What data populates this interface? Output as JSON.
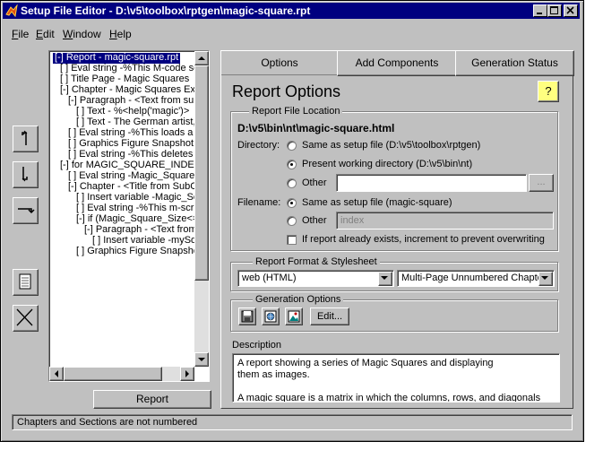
{
  "window": {
    "title": "Setup File Editor - D:\\v5\\toolbox\\rptgen\\magic-square.rpt"
  },
  "menu": [
    {
      "label": "File",
      "accel": "F",
      "rest": "ile"
    },
    {
      "label": "Edit",
      "accel": "E",
      "rest": "dit"
    },
    {
      "label": "Window",
      "accel": "W",
      "rest": "indow"
    },
    {
      "label": "Help",
      "accel": "H",
      "rest": "elp"
    }
  ],
  "tree": [
    "[-] Report - magic-square.rpt",
    "[ ] Eval string -%This M-code se",
    "[ ] Title Page - Magic Squares",
    "[-] Chapter - Magic Squares Exp",
    "[-] Paragraph - <Text from sub",
    "[ ] Text - %<help('magic')>",
    "[ ] Text - The German artist,",
    "[ ] Eval string -%This loads a s",
    "[ ] Graphics Figure Snapshot",
    "[ ] Eval string -%This deletes t",
    "[-] for MAGIC_SQUARE_INDEX",
    "[ ] Eval string -Magic_Square_",
    "[-] Chapter - <Title from SubCo",
    "[ ] Insert variable -Magic_Sc",
    "[ ] Eval string -%This m-scrip",
    "[-] if (Magic_Square_Size<=",
    "[-] Paragraph - <Text from",
    "[ ] Insert variable -mySqu",
    "[ ] Graphics Figure Snapshot"
  ],
  "report_button": "Report",
  "tabs": [
    "Options",
    "Add Components",
    "Generation Status"
  ],
  "options": {
    "heading": "Report Options",
    "help_glyph": "?",
    "file_location": {
      "group_title": "Report File Location",
      "path": "D:\\v5\\bin\\nt\\magic-square.html",
      "directory_label": "Directory:",
      "dir_options": [
        "Same as setup file (D:\\v5\\toolbox\\rptgen)",
        "Present working directory (D:\\v5\\bin\\nt)",
        "Other"
      ],
      "dir_selected": 1,
      "other_dir_value": "",
      "browse_label": "...",
      "filename_label": "Filename:",
      "file_options": [
        "Same as setup file (magic-square)",
        "Other"
      ],
      "file_selected": 0,
      "other_file_value": "index",
      "increment_label": "If report already exists, increment to prevent overwriting",
      "increment_checked": false
    },
    "format": {
      "group_title": "Report Format & Stylesheet",
      "format_value": "web (HTML)",
      "stylesheet_value": "Multi-Page Unnumbered Chapter"
    },
    "generation": {
      "group_title": "Generation Options",
      "edit_label": "Edit..."
    },
    "description": {
      "label": "Description",
      "lines": [
        "A report showing a series of Magic Squares and displaying",
        "them as images.",
        "",
        "A magic square is a matrix in which the columns, rows, and diagonals"
      ]
    }
  },
  "status_text": "Chapters and Sections are not numbered"
}
